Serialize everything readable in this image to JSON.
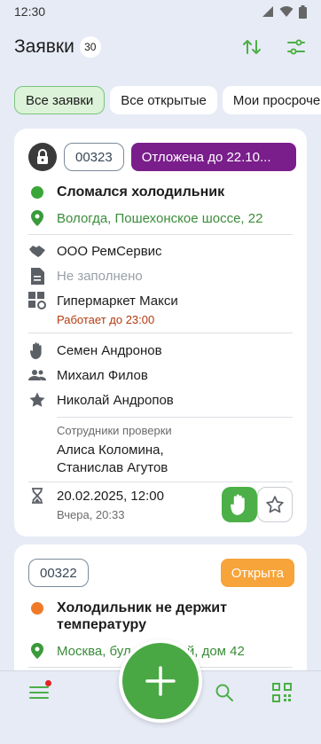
{
  "status_bar": {
    "time": "12:30"
  },
  "header": {
    "title": "Заявки",
    "count": "30"
  },
  "chips": [
    {
      "label": "Все заявки"
    },
    {
      "label": "Все открытые"
    },
    {
      "label": "Мои просроче"
    }
  ],
  "cards": [
    {
      "id": "00323",
      "status": "Отложена до 22.10...",
      "title": "Сломался холодильник",
      "address": "Вологда, Пошехонское шоссе, 22",
      "company": "ООО РемСервис",
      "document": "Не заполнено",
      "object": "Гипермаркет Макси",
      "working_hours": "Работает до 23:00",
      "executor": "Семен Андронов",
      "team": "Михаил Филов",
      "author": "Николай Андропов",
      "inspectors_label": "Сотрудники проверки",
      "inspectors_line1": "Алиса Коломина,",
      "inspectors_line2": "Станислав Агутов",
      "deadline": "20.02.2025, 12:00",
      "created": "Вчера, 20:33"
    },
    {
      "id": "00322",
      "status": "Открыта",
      "title_line1": "Холодильник не держит",
      "title_line2": "температуру",
      "address": "Москва, бул. Большой, дом 42"
    }
  ],
  "colors": {
    "accent_green": "#4caf47",
    "postponed_purple": "#7a1e8c",
    "open_orange": "#f7a43a",
    "dot_green": "#3aa63a",
    "dot_orange": "#f07a28",
    "notification_red": "#e02424"
  },
  "icons": {
    "status_bar": [
      "signal-icon",
      "wifi-icon",
      "battery-icon"
    ],
    "header": [
      "sort-icon",
      "filter-icon"
    ],
    "bottom_nav": [
      "menu-icon",
      "search-icon",
      "qr-code-icon"
    ],
    "fab": "plus-icon"
  }
}
